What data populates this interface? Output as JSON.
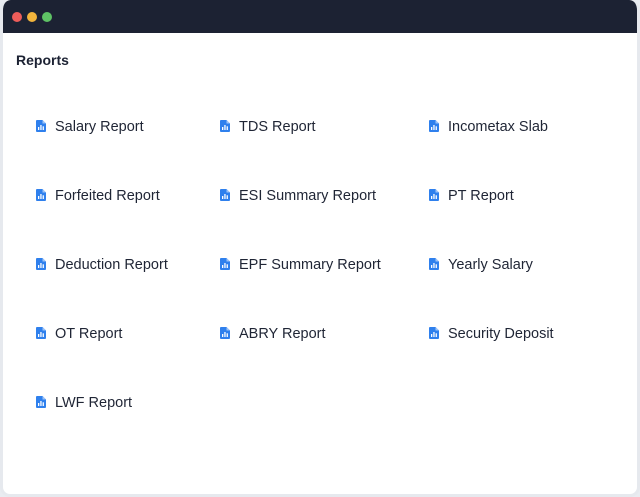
{
  "page": {
    "title": "Reports"
  },
  "colors": {
    "titlebar": "#1c2233",
    "icon": "#2f80ed"
  },
  "reports": [
    {
      "label": "Salary Report",
      "icon": "report-icon"
    },
    {
      "label": "TDS Report",
      "icon": "report-icon"
    },
    {
      "label": "Incometax Slab",
      "icon": "report-icon"
    },
    {
      "label": "Forfeited Report",
      "icon": "report-icon"
    },
    {
      "label": "ESI Summary Report",
      "icon": "report-icon"
    },
    {
      "label": "PT Report",
      "icon": "report-icon"
    },
    {
      "label": "Deduction Report",
      "icon": "report-icon"
    },
    {
      "label": "EPF Summary Report",
      "icon": "report-icon"
    },
    {
      "label": "Yearly Salary",
      "icon": "report-icon"
    },
    {
      "label": "OT Report",
      "icon": "report-icon"
    },
    {
      "label": "ABRY Report",
      "icon": "report-icon"
    },
    {
      "label": "Security Deposit",
      "icon": "report-icon"
    },
    {
      "label": "LWF Report",
      "icon": "report-icon"
    }
  ]
}
